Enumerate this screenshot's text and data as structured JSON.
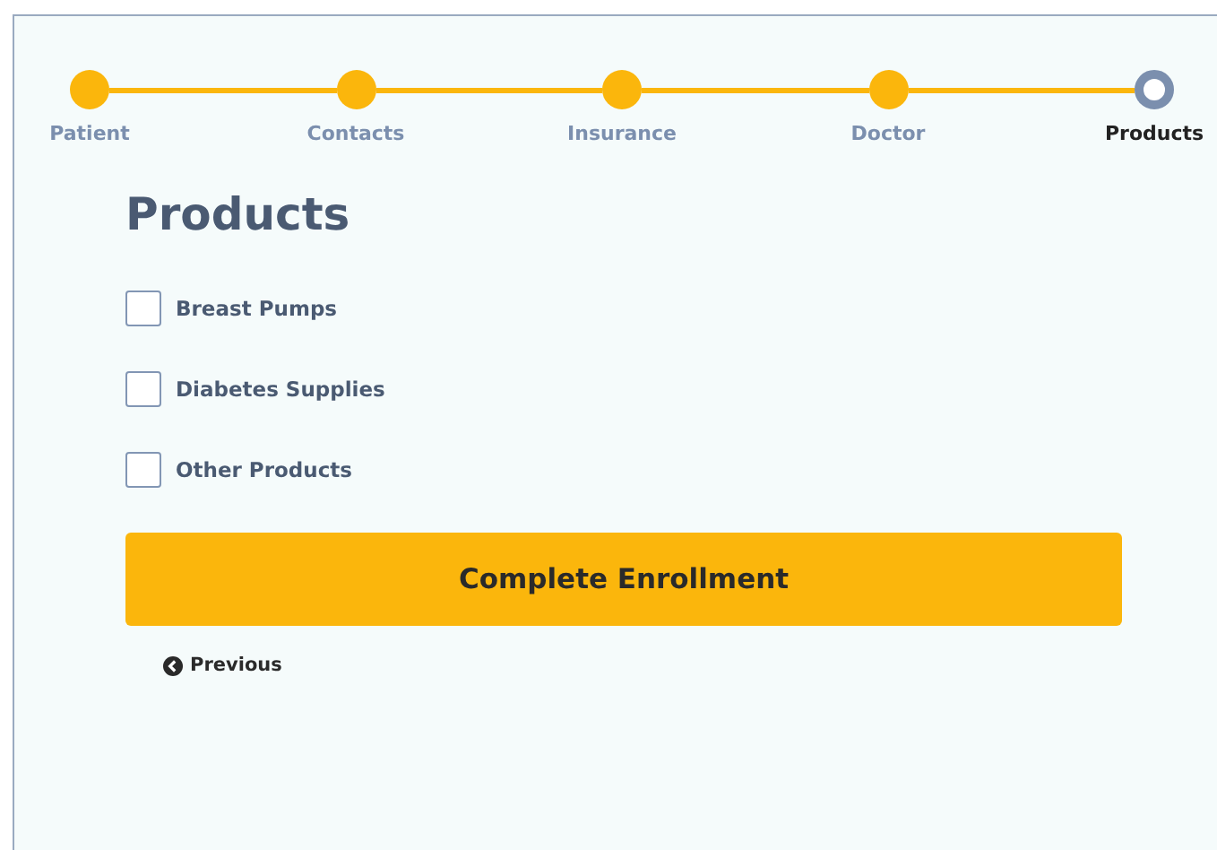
{
  "steps": [
    {
      "label": "Patient",
      "done": true,
      "selected": false
    },
    {
      "label": "Contacts",
      "done": true,
      "selected": false
    },
    {
      "label": "Insurance",
      "done": true,
      "selected": false
    },
    {
      "label": "Doctor",
      "done": true,
      "selected": false
    },
    {
      "label": "Products",
      "done": false,
      "selected": true
    }
  ],
  "title": "Products",
  "options": [
    {
      "label": "Breast Pumps",
      "checked": false
    },
    {
      "label": "Diabetes Supplies",
      "checked": false
    },
    {
      "label": "Other Products",
      "checked": false
    }
  ],
  "submit": "Complete Enrollment",
  "previous": "Previous"
}
